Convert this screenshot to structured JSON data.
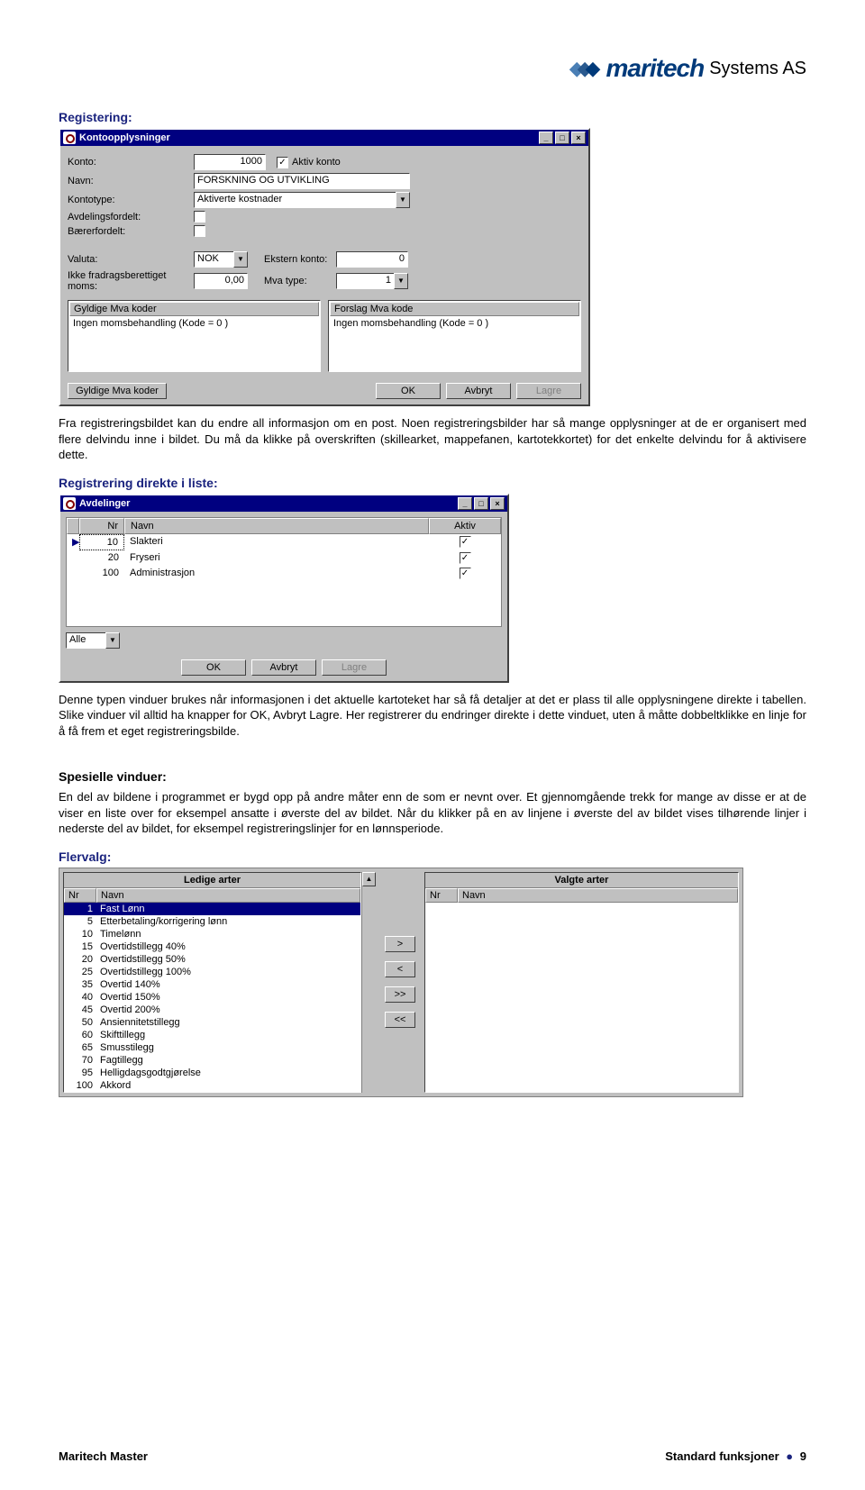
{
  "brand": {
    "name": "maritech",
    "suffix": "Systems AS"
  },
  "sections": {
    "registering_title": "Registering:",
    "registering_body": "Fra registreringsbildet kan du endre all informasjon om en post. Noen registreringsbilder har så mange opplysninger at de er organisert med flere delvindu inne i bildet. Du må da klikke på overskriften (skillearket, mappefanen, kartotekkortet) for det enkelte delvindu for å aktivisere dette.",
    "direkte_title": "Registrering direkte i liste:",
    "direkte_body": "Denne typen vinduer brukes når informasjonen i det aktuelle kartoteket har så få detaljer at det er plass til alle opplysningene direkte i tabellen. Slike vinduer vil alltid ha knapper for OK, Avbryt Lagre. Her registrerer du endringer direkte i dette vinduet, uten å måtte dobbeltklikke en linje for å få frem et eget registreringsbilde.",
    "spesielle_title": "Spesielle vinduer:",
    "spesielle_body": "En del av bildene i programmet er bygd opp på andre måter enn de som er nevnt over. Et gjennomgående trekk for mange av disse er at de viser en liste over for eksempel ansatte i øverste del av bildet. Når du klikker på en av linjene i øverste del av bildet vises tilhørende linjer i nederste del av bildet, for eksempel registreringslinjer for en lønnsperiode.",
    "flervalg_title": "Flervalg:"
  },
  "konto_window": {
    "title": "Kontoopplysninger",
    "labels": {
      "konto": "Konto:",
      "navn": "Navn:",
      "kontotype": "Kontotype:",
      "avd": "Avdelingsfordelt:",
      "baerer": "Bærerfordelt:",
      "valuta": "Valuta:",
      "ekstern": "Ekstern konto:",
      "ikkefradrag": "Ikke fradragsberettiget moms:",
      "mvatype": "Mva type:",
      "aktiv": "Aktiv konto"
    },
    "values": {
      "konto": "1000",
      "navn": "FORSKNING OG UTVIKLING",
      "kontotype": "Aktiverte kostnader",
      "valuta": "NOK",
      "ekstern": "0",
      "ikkefradrag": "0,00",
      "mvatype": "1",
      "aktiv_checked": "✓"
    },
    "lists": {
      "gyldige_head": "Gyldige Mva koder",
      "gyldige_item": "Ingen momsbehandling  (Kode = 0 )",
      "forslag_head": "Forslag Mva kode",
      "forslag_item": "Ingen momsbehandling  (Kode = 0 )"
    },
    "buttons": {
      "gyldige": "Gyldige Mva koder",
      "ok": "OK",
      "avbryt": "Avbryt",
      "lagre": "Lagre"
    }
  },
  "avdelinger_window": {
    "title": "Avdelinger",
    "columns": {
      "nr": "Nr",
      "navn": "Navn",
      "aktiv": "Aktiv"
    },
    "rows": [
      {
        "nr": "10",
        "navn": "Slakteri",
        "aktiv": "✓"
      },
      {
        "nr": "20",
        "navn": "Fryseri",
        "aktiv": "✓"
      },
      {
        "nr": "100",
        "navn": "Administrasjon",
        "aktiv": "✓"
      }
    ],
    "filter": "Alle",
    "buttons": {
      "ok": "OK",
      "avbryt": "Avbryt",
      "lagre": "Lagre"
    }
  },
  "flervalg_window": {
    "ledige_title": "Ledige arter",
    "valgte_title": "Valgte arter",
    "columns": {
      "nr": "Nr",
      "navn": "Navn"
    },
    "ledige": [
      {
        "nr": "1",
        "navn": "Fast Lønn"
      },
      {
        "nr": "5",
        "navn": "Etterbetaling/korrigering lønn"
      },
      {
        "nr": "10",
        "navn": "Timelønn"
      },
      {
        "nr": "15",
        "navn": "Overtidstillegg 40%"
      },
      {
        "nr": "20",
        "navn": "Overtidstillegg 50%"
      },
      {
        "nr": "25",
        "navn": "Overtidstillegg 100%"
      },
      {
        "nr": "35",
        "navn": "Overtid 140%"
      },
      {
        "nr": "40",
        "navn": "Overtid 150%"
      },
      {
        "nr": "45",
        "navn": "Overtid 200%"
      },
      {
        "nr": "50",
        "navn": "Ansiennitetstillegg"
      },
      {
        "nr": "60",
        "navn": "Skifttillegg"
      },
      {
        "nr": "65",
        "navn": "Smusstilegg"
      },
      {
        "nr": "70",
        "navn": "Fagtillegg"
      },
      {
        "nr": "95",
        "navn": "Helligdagsgodtgjørelse"
      },
      {
        "nr": "100",
        "navn": "Akkord"
      }
    ],
    "buttons": {
      "add": ">",
      "remove": "<",
      "addall": ">>",
      "removeall": "<<"
    }
  },
  "footer": {
    "left": "Maritech Master",
    "right_text": "Standard funksjoner",
    "bullet": "●",
    "page": "9"
  }
}
